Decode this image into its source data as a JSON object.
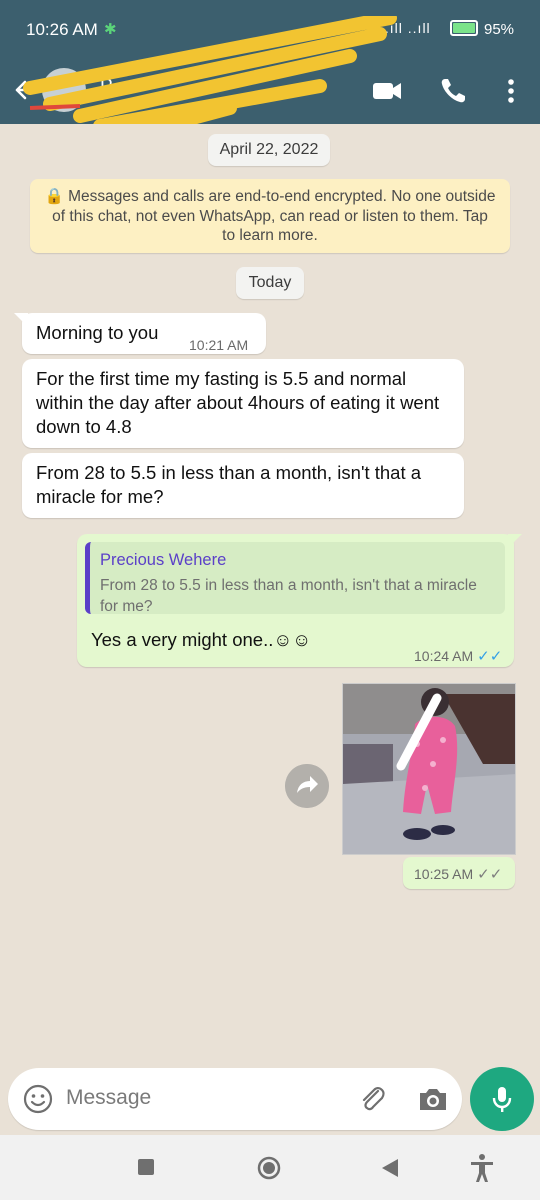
{
  "status_bar": {
    "time": "10:26 AM",
    "signal": "..ıll ..ıll",
    "battery_pct": "95%"
  },
  "header": {
    "contact_name": "P"
  },
  "chat": {
    "date_label": "April 22, 2022",
    "encryption_notice": "🔒 Messages and calls are end-to-end encrypted. No one outside of this chat, not even WhatsApp, can read or listen to them. Tap to learn more.",
    "today_label": "Today",
    "messages": [
      {
        "text": "Morning to you",
        "time": "10:21 AM"
      },
      {
        "text": "For the first time my fasting is 5.5 and normal within the day after about 4hours of eating it went down to 4.8"
      },
      {
        "text": "From 28 to 5.5 in less than a month, isn't that a miracle for me?"
      },
      {
        "quote_author": "Precious Wehere",
        "quote_text": "From 28 to 5.5 in less than a month, isn't that a miracle for me?",
        "text": "Yes a very might one..☺☺",
        "time": "10:24 AM"
      },
      {
        "time": "10:25 AM"
      }
    ]
  },
  "input": {
    "placeholder": "Message"
  },
  "colors": {
    "header": "#3c5f6e",
    "outgoing": "#e4f8cf",
    "incoming": "#ffffff",
    "accent": "#1ea880",
    "quote_author": "#5b40c8",
    "read_ticks": "#34a0e6"
  },
  "icons": [
    "back-arrow-icon",
    "video-call-icon",
    "phone-icon",
    "more-options-icon",
    "forward-icon",
    "emoji-icon",
    "attach-icon",
    "camera-icon",
    "mic-icon",
    "recents-icon",
    "home-icon",
    "back-icon",
    "accessibility-icon"
  ]
}
